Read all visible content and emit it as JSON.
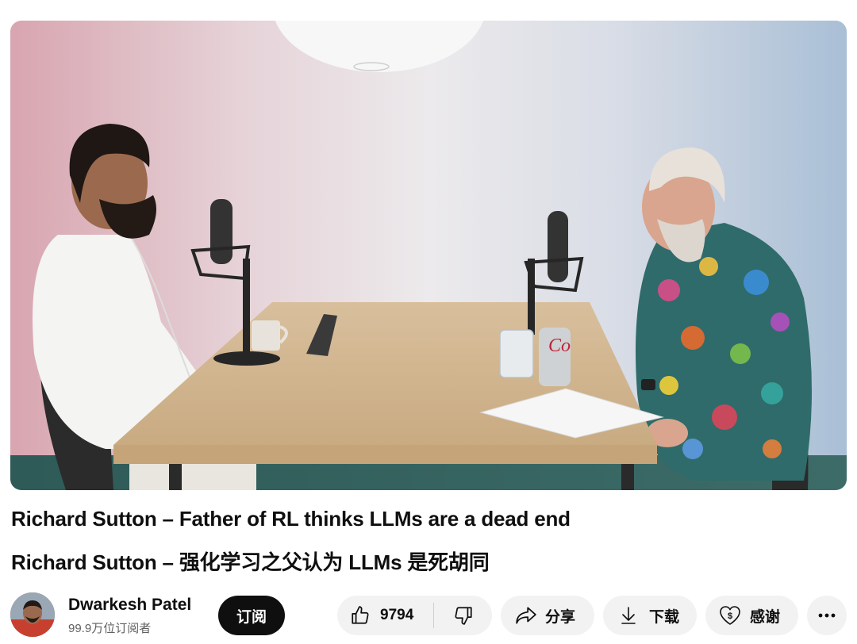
{
  "video": {
    "title_en": "Richard Sutton – Father of RL thinks LLMs are a dead end",
    "title_zh": "Richard Sutton – 强化学习之父认为 LLMs 是死胡同",
    "can_label": "Co"
  },
  "channel": {
    "name": "Dwarkesh Patel",
    "subscribers": "99.9万位订阅者"
  },
  "actions": {
    "subscribe_label": "订阅",
    "like_count": "9794",
    "share_label": "分享",
    "download_label": "下载",
    "thanks_label": "感谢",
    "more_icon": "ellipsis-icon"
  },
  "colors": {
    "subscribe_bg": "#0f0f0f",
    "pill_bg": "#f2f2f2",
    "text_primary": "#0f0f0f",
    "text_secondary": "#606060"
  }
}
